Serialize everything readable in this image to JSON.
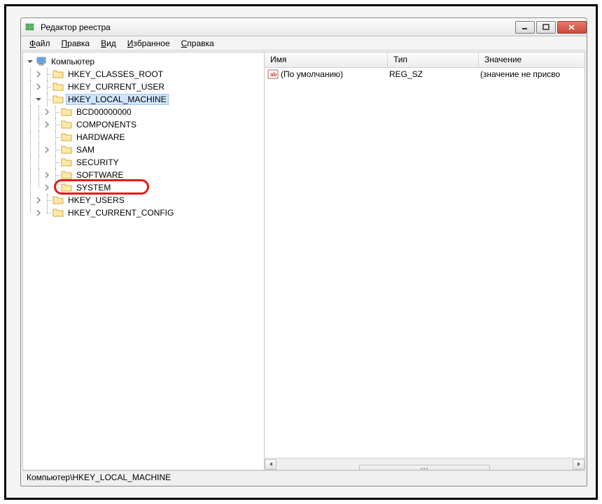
{
  "window": {
    "title": "Редактор реестра"
  },
  "menu": {
    "file": "айл",
    "file_u": "Ф",
    "edit": "равка",
    "edit_u": "П",
    "view": "ид",
    "view_u": "В",
    "favorites": "збранное",
    "favorites_u": "И",
    "help": "правка",
    "help_u": "С"
  },
  "tree": {
    "root": "Компьютер",
    "hkcr": "HKEY_CLASSES_ROOT",
    "hkcu": "HKEY_CURRENT_USER",
    "hklm": "HKEY_LOCAL_MACHINE",
    "hklm_children": {
      "bcd": "BCD00000000",
      "components": "COMPONENTS",
      "hardware": "HARDWARE",
      "sam": "SAM",
      "security": "SECURITY",
      "software": "SOFTWARE",
      "system": "SYSTEM"
    },
    "hku": "HKEY_USERS",
    "hkcc": "HKEY_CURRENT_CONFIG"
  },
  "list": {
    "columns": {
      "name": "Имя",
      "type": "Тип",
      "value": "Значение"
    },
    "col_widths": {
      "name": 176,
      "type": 130,
      "value": 130
    },
    "rows": [
      {
        "name": "(По умолчанию)",
        "type": "REG_SZ",
        "value": "(значение не присво"
      }
    ]
  },
  "statusbar": {
    "path": "Компьютер\\HKEY_LOCAL_MACHINE"
  },
  "colors": {
    "annotation": "#e41b1b"
  }
}
